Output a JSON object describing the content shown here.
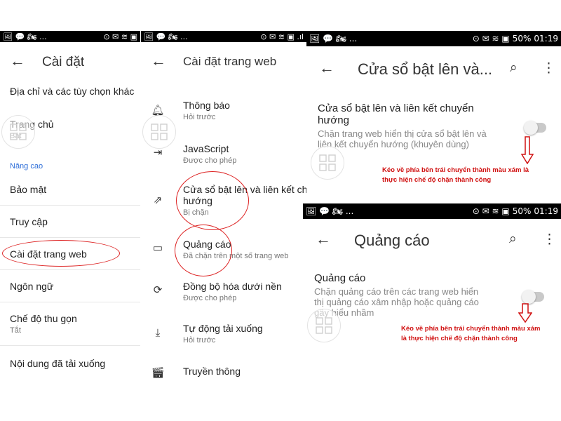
{
  "status": {
    "left_panel": {
      "icons": "🖼 💬 🏍 ...",
      "right_icons": "⊙ ✉ ≋ ▣"
    },
    "mid_panel": {
      "icons": "🖼 💬 🏍 ...",
      "right_icons": "⊙ ✉ ≋ ▣ .ıl"
    },
    "battery": "50%",
    "time": "01:19"
  },
  "screen1": {
    "title": "Cài đặt",
    "items": [
      {
        "title": "Địa chỉ và các tùy chọn khác"
      },
      {
        "title": "Trang chủ",
        "subtitle": "Bật"
      },
      {
        "section": "Nâng cao"
      },
      {
        "title": "Bảo mật"
      },
      {
        "title": "Truy cập"
      },
      {
        "title": "Cài đặt trang web"
      },
      {
        "title": "Ngôn ngữ"
      },
      {
        "title": "Chế độ thu gọn",
        "subtitle": "Tắt"
      },
      {
        "title": "Nội dung đã tải xuống"
      }
    ]
  },
  "screen2": {
    "title": "Cài đặt trang web",
    "items": [
      {
        "icon": "bell-icon",
        "title": "Thông báo",
        "subtitle": "Hỏi trước"
      },
      {
        "icon": "javascript-icon",
        "title": "JavaScript",
        "subtitle": "Được cho phép"
      },
      {
        "icon": "external-link-icon",
        "title": "Cửa sổ bật lên và liên kết chuyển",
        "title2": "hướng",
        "subtitle": "Bị chặn"
      },
      {
        "icon": "ads-window-icon",
        "title": "Quảng cáo",
        "subtitle": "Đã chặn trên một số trang web"
      },
      {
        "icon": "sync-icon",
        "title": "Đồng bộ hóa dưới nền",
        "subtitle": "Được cho phép"
      },
      {
        "icon": "download-icon",
        "title": "Tự động tải xuống",
        "subtitle": "Hỏi trước"
      },
      {
        "icon": "media-icon",
        "title": "Truyền thông"
      }
    ]
  },
  "screen3": {
    "title": "Cửa sổ bật lên và...",
    "setting_title": "Cửa sổ bật lên và liên kết chuyển",
    "setting_title2": "hướng",
    "setting_desc": "Chặn trang web hiển thị cửa sổ bật lên và",
    "setting_desc2": "liên kết chuyển hướng (khuyên dùng)",
    "toggle_state": "off",
    "note_line1": "Kéo về phía bên trái chuyển thành màu xám là",
    "note_line2": "thực hiện chế độ chặn thành công"
  },
  "screen4": {
    "title": "Quảng cáo",
    "setting_title": "Quảng cáo",
    "setting_desc": "Chặn quảng cáo trên các trang web hiển",
    "setting_desc2": "thị quảng cáo xâm nhập hoặc quảng cáo",
    "setting_desc3": "gây hiểu nhầm",
    "toggle_state": "off",
    "note_line1": "Kéo về phía bên trái chuyển thành màu xám",
    "note_line2": "là thực hiện chế độ chặn thành công"
  },
  "colors": {
    "annotation": "#d01010",
    "toggle_off": "#c9c9c9",
    "status_bar": "#000000"
  }
}
